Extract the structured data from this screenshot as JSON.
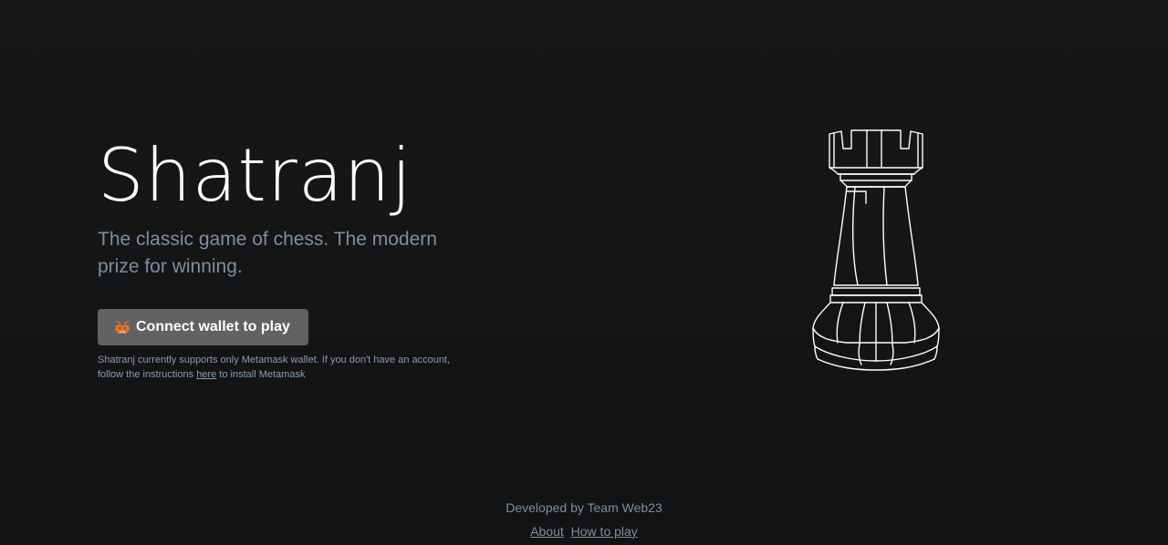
{
  "hero": {
    "title": "Shatranj",
    "subtitle": "The classic game of chess. The modern prize for winning.",
    "connect_button_label": "Connect wallet to play",
    "note_prefix": "Shatranj currently supports only Metamask wallet. If you don't have an account, follow the instructions ",
    "note_link": "here",
    "note_suffix": " to install Metamask"
  },
  "illustration": {
    "icon": "rook-chess-piece-icon",
    "stroke_color": "#ffffff"
  },
  "footer": {
    "credit": "Developed by Team Web23",
    "links": [
      "About",
      "How to play"
    ]
  },
  "colors": {
    "background": "#151515",
    "accent_text": "#7d8ea3",
    "button_bg": "#626262"
  }
}
